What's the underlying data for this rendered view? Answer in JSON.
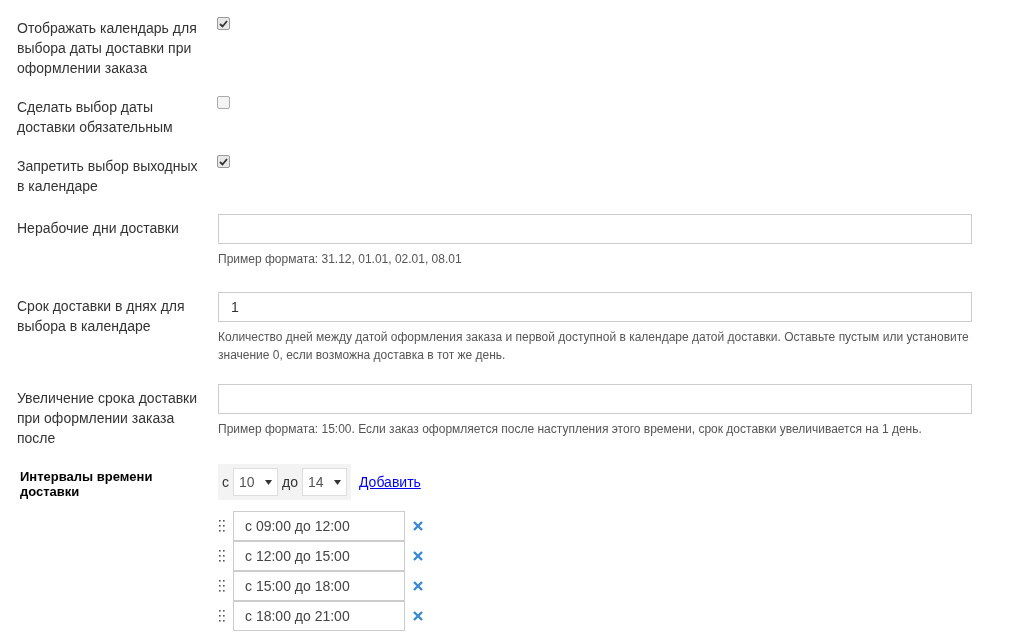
{
  "checkbox_rows": [
    {
      "label": "Отображать календарь для выбора даты доставки при оформлении заказа",
      "checked": true
    },
    {
      "label": "Сделать выбор даты доставки обязательным",
      "checked": false
    },
    {
      "label": "Запретить выбор выходных в календаре",
      "checked": true
    }
  ],
  "field_rows": [
    {
      "label": "Нерабочие дни доставки",
      "value": "",
      "hint": "Пример формата: 31.12, 01.01, 02.01, 08.01"
    },
    {
      "label": "Срок доставки в днях для выбора в календаре",
      "value": "1",
      "hint": "Количество дней между датой оформления заказа и первой доступной в календаре датой доставки. Оставьте пустым или установите значение 0, если возможна доставка в тот же день."
    },
    {
      "label": "Увеличение срока доставки при оформлении заказа после",
      "value": "",
      "hint": "Пример формата: 15:00. Если заказ оформляется после наступления этого времени, срок доставки увеличивается на 1 день."
    }
  ],
  "intervals": {
    "label": "Интервалы времени доставки",
    "from_label": "с",
    "from_value": "10",
    "to_label": "до",
    "to_value": "14",
    "add_link": "Добавить",
    "items": [
      "с 09:00 до 12:00",
      "с 12:00 до 15:00",
      "с 15:00 до 18:00",
      "с 18:00 до 21:00"
    ]
  }
}
